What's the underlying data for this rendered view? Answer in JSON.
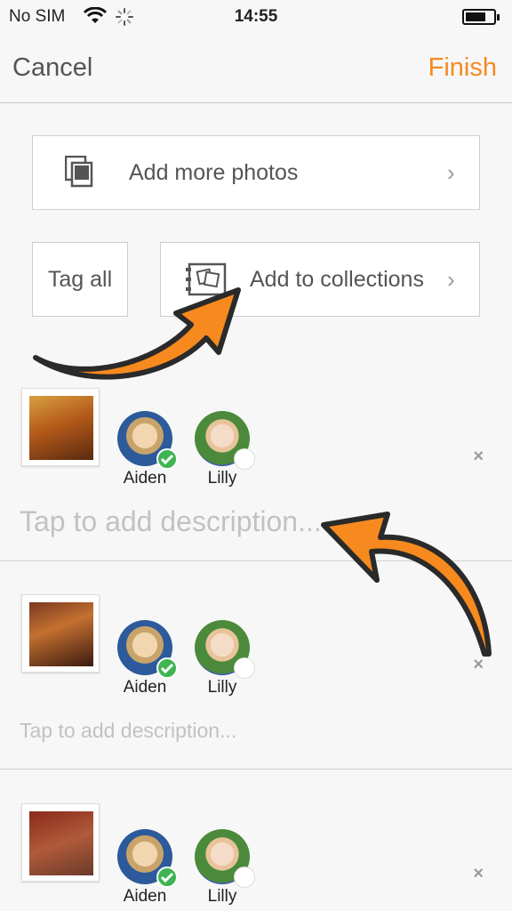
{
  "status_bar": {
    "carrier": "No SIM",
    "time": "14:55"
  },
  "nav": {
    "cancel_label": "Cancel",
    "finish_label": "Finish"
  },
  "actions": {
    "add_more_label": "Add more photos",
    "tag_all_label": "Tag all",
    "add_collections_label": "Add to collections",
    "chevron": "›"
  },
  "photos": [
    {
      "people": [
        {
          "name": "Aiden",
          "selected": true
        },
        {
          "name": "Lilly",
          "selected": false
        }
      ],
      "description_placeholder": "Tap to add description..."
    },
    {
      "people": [
        {
          "name": "Aiden",
          "selected": true
        },
        {
          "name": "Lilly",
          "selected": false
        }
      ],
      "description_placeholder": "Tap to add description..."
    },
    {
      "people": [
        {
          "name": "Aiden",
          "selected": true
        },
        {
          "name": "Lilly",
          "selected": false
        }
      ]
    }
  ],
  "remove_glyph": "×",
  "colors": {
    "accent": "#f68a1f",
    "check": "#3fb452"
  }
}
